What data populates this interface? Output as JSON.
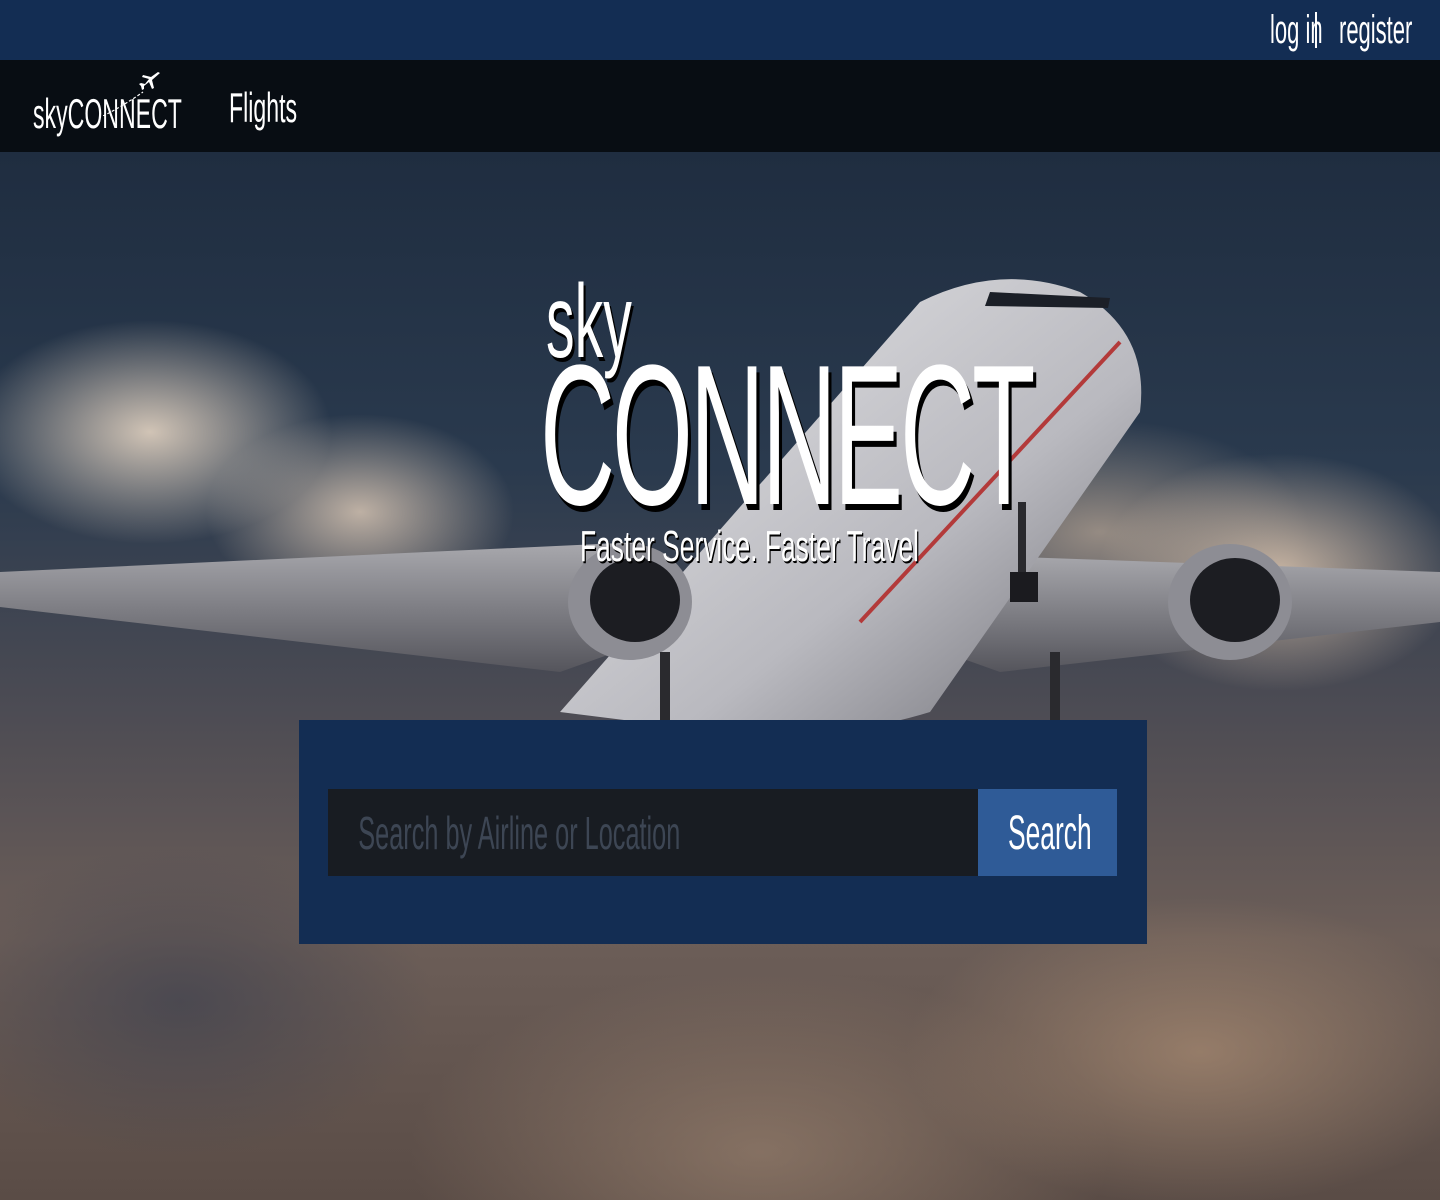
{
  "topbar": {
    "login_label": "log in",
    "register_label": "register"
  },
  "navbar": {
    "logo_text": "skyCONNECT",
    "flights_label": "Flights"
  },
  "hero": {
    "title_small": "sky",
    "title_large": "CONNECT",
    "tagline": "Faster Service. Faster Travel"
  },
  "search": {
    "placeholder": "Search by Airline or Location",
    "button_label": "Search"
  },
  "colors": {
    "topbar": "#132d53",
    "navbar": "#080d13",
    "search_panel": "#132d53",
    "search_button": "#2f5b97",
    "search_input": "#181c22"
  }
}
